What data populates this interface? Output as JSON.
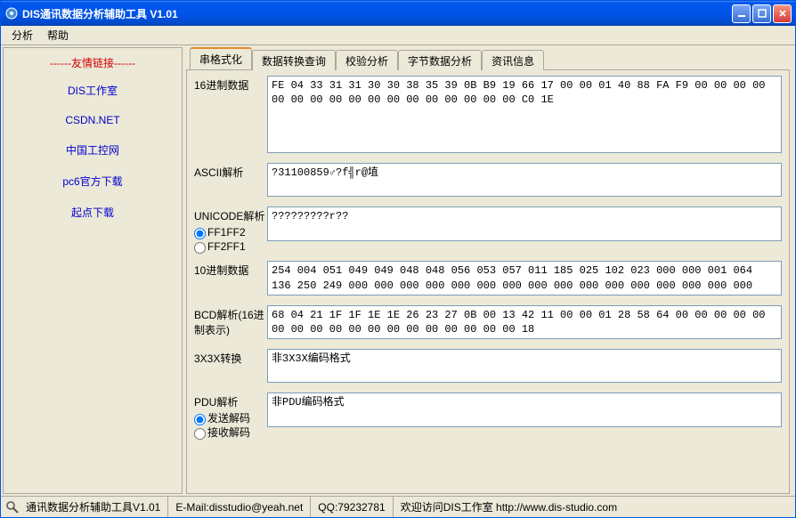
{
  "window": {
    "title": "DIS通讯数据分析辅助工具  V1.01"
  },
  "menu": {
    "analyze": "分析",
    "help": "帮助"
  },
  "sidebar": {
    "header": "------友情链接------",
    "links": [
      "DIS工作室",
      "CSDN.NET",
      "中国工控网",
      "pc6官方下载",
      "起点下载"
    ]
  },
  "tabs": {
    "t0": "串格式化",
    "t1": "数据转换查询",
    "t2": "校验分析",
    "t3": "字节数据分析",
    "t4": "资讯信息"
  },
  "fields": {
    "hexdata": {
      "label": "16进制数据",
      "value": "FE 04 33 31 31 30 30 38 35 39 0B B9 19 66 17 00 00 01 40 88 FA F9 00 00 00 00 00 00 00 00 00 00 00 00 00 00 00 00 00 C0 1E"
    },
    "ascii": {
      "label": "ASCII解析",
      "value": "?31100859♂?f╣r@埴"
    },
    "unicode": {
      "label": "UNICODE解析",
      "opt1": "FF1FF2",
      "opt2": "FF2FF1",
      "value": "?????????r??"
    },
    "decdata": {
      "label": "10进制数据",
      "value": "254 004 051 049 049 048 048 056 053 057 011 185 025 102 023 000 000 001 064 136 250 249 000 000 000 000 000 000 000 000 000 000 000 000 000 000 000 000 000 192 030"
    },
    "bcd": {
      "label": "BCD解析(16进制表示)",
      "value": "68 04 21 1F 1F 1E 1E 26 23 27 0B 00 13 42 11 00 00 01 28 58 64 00 00 00 00 00 00 00 00 00 00 00 00 00 00 00 00 00 00 18"
    },
    "x3x": {
      "label": "3X3X转换",
      "value": "非3X3X编码格式"
    },
    "pdu": {
      "label": "PDU解析",
      "opt1": "发送解码",
      "opt2": "接收解码",
      "value": "非PDU编码格式"
    }
  },
  "status": {
    "app": "通讯数据分析辅助工具V1.01",
    "email": "E-Mail:disstudio@yeah.net",
    "qq": "QQ:79232781",
    "welcome": "欢迎访问DIS工作室 http://www.dis-studio.com"
  }
}
